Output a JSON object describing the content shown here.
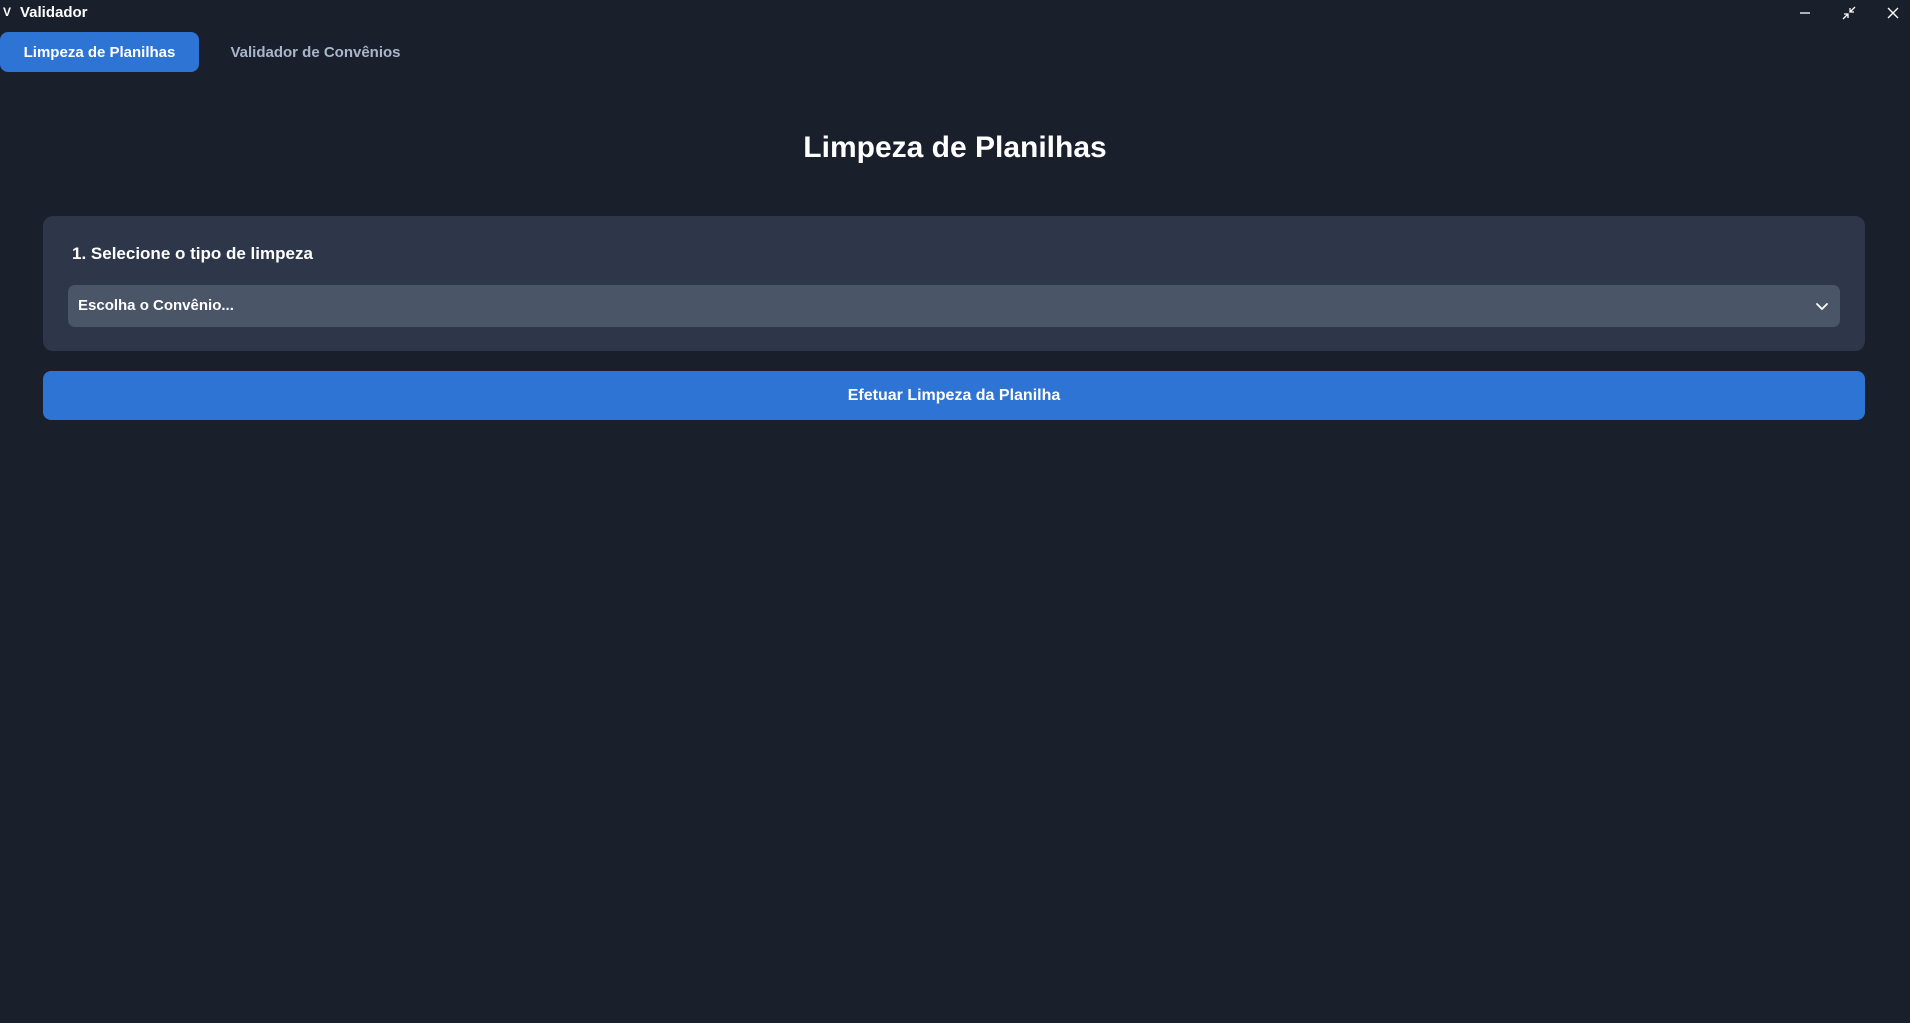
{
  "window": {
    "logo_letter": "V",
    "title": "Validador",
    "controls": {
      "minimize_icon": "minimize-icon",
      "restore_icon": "restore-icon",
      "close_icon": "close-icon"
    }
  },
  "tabs": [
    {
      "label": "Limpeza de Planilhas",
      "active": true
    },
    {
      "label": "Validador de Convênios",
      "active": false
    }
  ],
  "main": {
    "title": "Limpeza de Planilhas",
    "step_card": {
      "heading": "1. Selecione o tipo de limpeza",
      "select": {
        "value": "Escolha o Convênio...",
        "icon": "chevron-down-icon"
      }
    },
    "action_button_label": "Efetuar Limpeza da Planilha"
  },
  "colors": {
    "background": "#1a1f2c",
    "card": "#2e374a",
    "select": "#4a5568",
    "accent": "#2e74d5",
    "inactive_tab_text": "#a9b6c9"
  }
}
